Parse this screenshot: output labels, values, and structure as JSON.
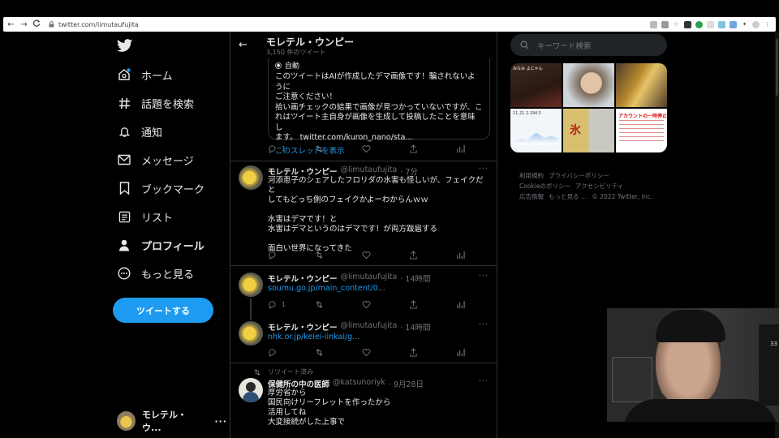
{
  "browser": {
    "url": "twitter.com/limutaufujita",
    "back": "←",
    "forward": "→",
    "reload": "C",
    "lock": "🔒"
  },
  "sidebar": {
    "items": [
      {
        "label": "ホーム",
        "icon": "home-icon"
      },
      {
        "label": "話題を検索",
        "icon": "hashtag-icon"
      },
      {
        "label": "通知",
        "icon": "bell-icon"
      },
      {
        "label": "メッセージ",
        "icon": "mail-icon"
      },
      {
        "label": "ブックマーク",
        "icon": "bookmark-icon"
      },
      {
        "label": "リスト",
        "icon": "list-icon"
      },
      {
        "label": "プロフィール",
        "icon": "profile-icon"
      },
      {
        "label": "もっと見る",
        "icon": "more-icon"
      }
    ],
    "tweet_button": "ツイートする",
    "account_name": "モレテル・ウ...",
    "account_more": "···"
  },
  "header": {
    "back": "←",
    "name": "モレテル・ウンピー",
    "count": "3,150 件のツイート"
  },
  "notice": {
    "auto_label": "自動",
    "body": "このツイートはAIが作成したデマ画像です！騙されないように\nご注意ください！\n拾い画チェックの結果で画像が見つかっていないですが、こ\nれはツイート主自身が画像を生成して投稿したことを意味し\nます。 twitter.com/kuron_nano/sta...",
    "thread_link": "このスレッドを表示",
    "reply_count": "1"
  },
  "tweets": [
    {
      "name": "モレテル・ウンピー",
      "handle": "@limutaufujita",
      "time": "· 7分",
      "text": "河添恵子のシェアしたフロリダの水害も怪しいが、フェイクだと\nしてもどっち側のフェイクかよーわからんｗｗ\n\n水害はデマです！と\n水害はデマというのはデマです！が両方跋扈する\n\n面白い世界になってきた",
      "reply_count": ""
    },
    {
      "name": "モレテル・ウンピー",
      "handle": "@limutaufujita",
      "time": "· 14時間",
      "link": "soumu.go.jp/main_content/0...",
      "reply_count": "1"
    },
    {
      "name": "モレテル・ウンピー",
      "handle": "@limutaufujita",
      "time": "· 14時間",
      "link": "nhk.or.jp/keiei-iinkai/g...",
      "reply_count": ""
    },
    {
      "retweet_label": "リツイート済み",
      "name": "保健所の中の医師",
      "handle": "@katsunoriyk",
      "time": "· 9月28日",
      "text": "厚労省から\n国民向けリーフレットを作ったから\n活用してね\n大変接続がした上事で"
    }
  ],
  "more": "···",
  "right": {
    "search_placeholder": "キーワード検索",
    "media_labels": {
      "top_left": "みなみ よにゃん",
      "bottom_left": "11.21 2.194.5",
      "bottom_right": "アカウントの一時停止措置"
    },
    "footer": [
      "利用規約",
      "プライバシーポリシー",
      "Cookieのポリシー",
      "アクセシビリティ",
      "広告情報",
      "もっと見る …",
      "© 2022 Twitter, Inc."
    ]
  },
  "webcam": {
    "number": "33"
  },
  "colors": {
    "accent": "#1d9bf0",
    "background": "#000000",
    "text": "#e7e9ea",
    "muted": "#71767b",
    "border": "#2f3336"
  }
}
